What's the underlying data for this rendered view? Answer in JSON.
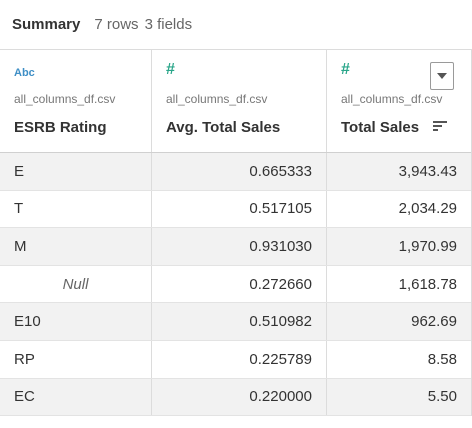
{
  "summary": {
    "title": "Summary",
    "rows_text": "7 rows",
    "fields_text": "3 fields"
  },
  "columns": [
    {
      "type_icon": "string-type-icon",
      "type_label": "Abc",
      "source": "all_columns_df.csv",
      "name": "ESRB Rating"
    },
    {
      "type_icon": "number-type-icon",
      "type_label": "#",
      "source": "all_columns_df.csv",
      "name": "Avg. Total Sales"
    },
    {
      "type_icon": "number-type-icon",
      "type_label": "#",
      "source": "all_columns_df.csv",
      "name": "Total Sales",
      "sort": "descending",
      "dropdown_icon": "dropdown-arrow-icon"
    }
  ],
  "rows": [
    {
      "rating": "E",
      "avg": "0.665333",
      "total": "3,943.43"
    },
    {
      "rating": "T",
      "avg": "0.517105",
      "total": "2,034.29"
    },
    {
      "rating": "M",
      "avg": "0.931030",
      "total": "1,970.99"
    },
    {
      "rating": "Null",
      "avg": "0.272660",
      "total": "1,618.78",
      "null": true
    },
    {
      "rating": "E10",
      "avg": "0.510982",
      "total": "962.69"
    },
    {
      "rating": "RP",
      "avg": "0.225789",
      "total": "8.58"
    },
    {
      "rating": "EC",
      "avg": "0.220000",
      "total": "5.50"
    }
  ],
  "colors": {
    "string_type": "#3f8fc6",
    "number_type": "#2aa68a",
    "row_shade": "#f2f2f2",
    "border": "#dcdcdc"
  }
}
